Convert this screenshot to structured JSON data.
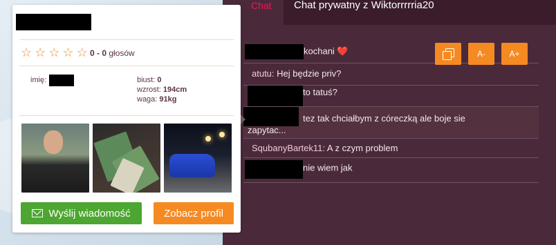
{
  "tabs": {
    "chat": "Chat",
    "private": "Chat prywatny z Wiktorrrrria20"
  },
  "tools": {
    "copy_icon": "copy-icon",
    "font_down": "A-",
    "font_up": "A+"
  },
  "messages": [
    {
      "text": "kochani ❤️"
    },
    {
      "nick": "atutu:",
      "text": " Hej będzie priv?"
    },
    {
      "text": "to tatuś?"
    },
    {
      "text": "tez tak chciałbym z córeczką ale boje sie zapytac..."
    },
    {
      "nick": "SqubanyBartek11:",
      "text": " A z czym problem"
    },
    {
      "text": "nie wiem jak"
    }
  ],
  "profile": {
    "rating_text": "0 - 0",
    "rating_suffix": " głosów",
    "stars": 0,
    "name_label": "imię:",
    "bust_label": "biust:",
    "bust_value": "0",
    "height_label": "wzrost:",
    "height_value": "194cm",
    "weight_label": "waga:",
    "weight_value": "91kg",
    "send_message_label": "Wyślij wiadomość",
    "view_profile_label": "Zobacz profil"
  },
  "colors": {
    "accent_orange": "#f58a22",
    "accent_green": "#4da631",
    "panel_bg": "#4a2a3a",
    "tab_active_text": "#e8185a"
  }
}
